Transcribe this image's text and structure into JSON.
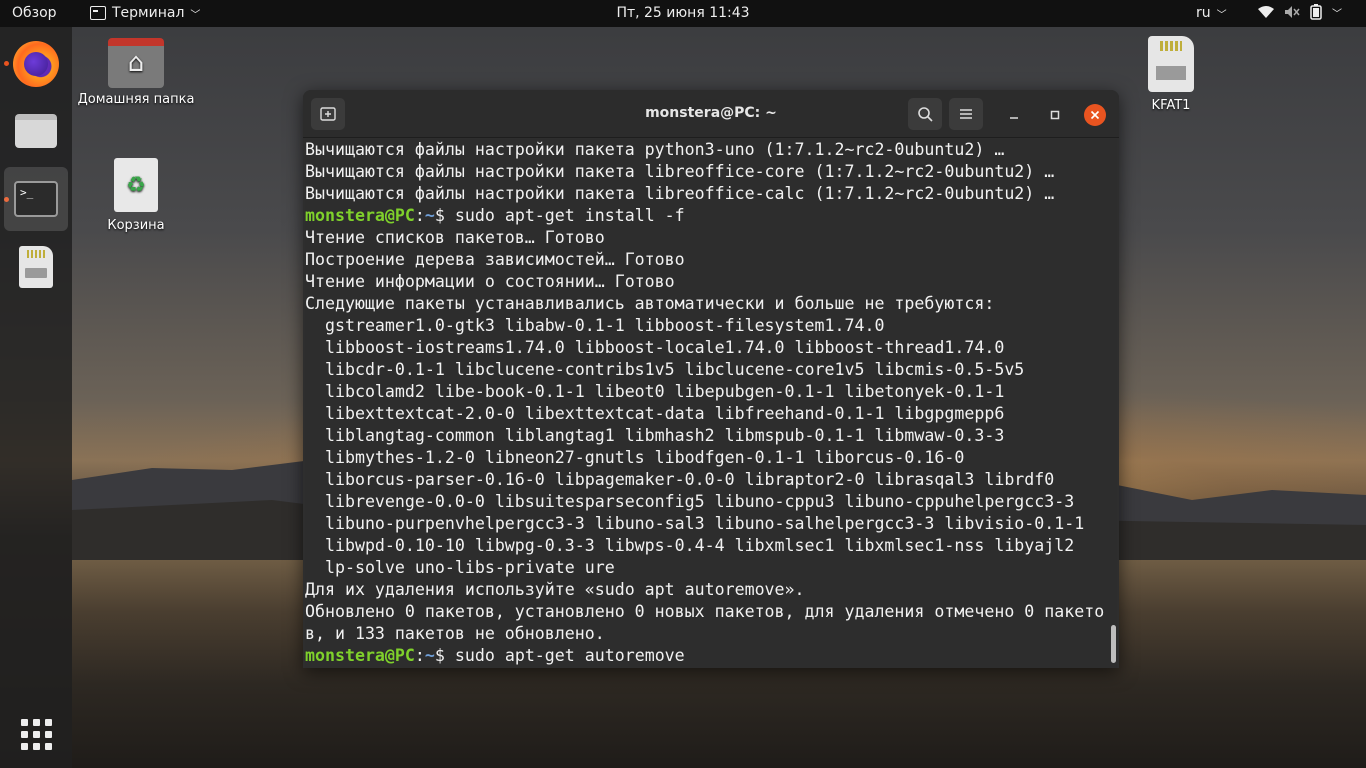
{
  "topbar": {
    "activities": "Обзор",
    "app_name": "Терминал",
    "clock": "Пт, 25 июня  11:43",
    "lang": "ru"
  },
  "desktop": {
    "home_label": "Домашняя папка",
    "trash_label": "Корзина",
    "drive_label": "KFAT1"
  },
  "terminal": {
    "title": "monstera@PC: ~",
    "lines": [
      {
        "text": "Вычищаются файлы настройки пакета python3-uno (1:7.1.2~rc2-0ubuntu2) …"
      },
      {
        "text": "Вычищаются файлы настройки пакета libreoffice-core (1:7.1.2~rc2-0ubuntu2) …"
      },
      {
        "text": "Вычищаются файлы настройки пакета libreoffice-calc (1:7.1.2~rc2-0ubuntu2) …"
      },
      {
        "prompt_user": "monstera@PC",
        "prompt_path": "~",
        "cmd": "$ sudo apt-get install -f"
      },
      {
        "text": "Чтение списков пакетов… Готово"
      },
      {
        "text": "Построение дерева зависимостей… Готово"
      },
      {
        "text": "Чтение информации о состоянии… Готово"
      },
      {
        "text": "Следующие пакеты устанавливались автоматически и больше не требуются:"
      },
      {
        "text": "  gstreamer1.0-gtk3 libabw-0.1-1 libboost-filesystem1.74.0"
      },
      {
        "text": "  libboost-iostreams1.74.0 libboost-locale1.74.0 libboost-thread1.74.0"
      },
      {
        "text": "  libcdr-0.1-1 libclucene-contribs1v5 libclucene-core1v5 libcmis-0.5-5v5"
      },
      {
        "text": "  libcolamd2 libe-book-0.1-1 libeot0 libepubgen-0.1-1 libetonyek-0.1-1"
      },
      {
        "text": "  libexttextcat-2.0-0 libexttextcat-data libfreehand-0.1-1 libgpgmepp6"
      },
      {
        "text": "  liblangtag-common liblangtag1 libmhash2 libmspub-0.1-1 libmwaw-0.3-3"
      },
      {
        "text": "  libmythes-1.2-0 libneon27-gnutls libodfgen-0.1-1 liborcus-0.16-0"
      },
      {
        "text": "  liborcus-parser-0.16-0 libpagemaker-0.0-0 libraptor2-0 librasqal3 librdf0"
      },
      {
        "text": "  librevenge-0.0-0 libsuitesparseconfig5 libuno-cppu3 libuno-cppuhelpergcc3-3"
      },
      {
        "text": "  libuno-purpenvhelpergcc3-3 libuno-sal3 libuno-salhelpergcc3-3 libvisio-0.1-1"
      },
      {
        "text": "  libwpd-0.10-10 libwpg-0.3-3 libwps-0.4-4 libxmlsec1 libxmlsec1-nss libyajl2"
      },
      {
        "text": "  lp-solve uno-libs-private ure"
      },
      {
        "text": "Для их удаления используйте «sudo apt autoremove»."
      },
      {
        "text": "Обновлено 0 пакетов, установлено 0 новых пакетов, для удаления отмечено 0 пакето"
      },
      {
        "text": "в, и 133 пакетов не обновлено."
      },
      {
        "prompt_user": "monstera@PC",
        "prompt_path": "~",
        "cmd": "$ sudo apt-get autoremove"
      }
    ]
  },
  "icons": {
    "new_tab": "new-tab-icon",
    "search": "search-icon",
    "menu": "hamburger-menu-icon",
    "minimize": "minimize-icon",
    "maximize": "maximize-icon",
    "close": "close-icon"
  },
  "colors": {
    "accent": "#e95420",
    "prompt_user": "#7fd12b",
    "prompt_path": "#6f9fd8",
    "terminal_bg": "#2d2d2d"
  }
}
